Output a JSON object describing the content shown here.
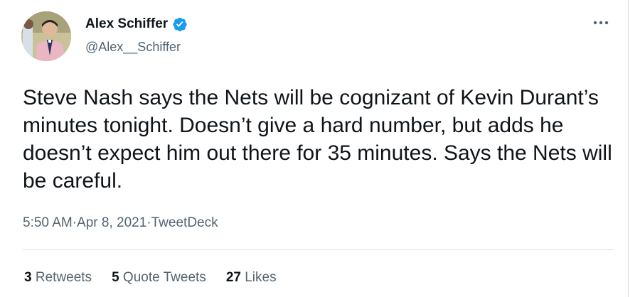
{
  "author": {
    "display_name": "Alex Schiffer",
    "handle": "@Alex__Schiffer",
    "verified": true
  },
  "tweet": {
    "text": "Steve Nash says the Nets will be cognizant of Kevin Durant’s minutes tonight. Doesn’t give a hard number, but adds he doesn’t expect him out there for 35 minutes. Says the Nets will be careful.",
    "time": "5:50 AM",
    "separator": " · ",
    "date": "Apr 8, 2021",
    "source": "TweetDeck"
  },
  "stats": {
    "retweets_count": "3",
    "retweets_label": "Retweets",
    "quotes_count": "5",
    "quotes_label": "Quote Tweets",
    "likes_count": "27",
    "likes_label": "Likes"
  },
  "colors": {
    "verified_blue": "#1d9bf0",
    "secondary_text": "#536471",
    "primary_text": "#0f1419"
  }
}
